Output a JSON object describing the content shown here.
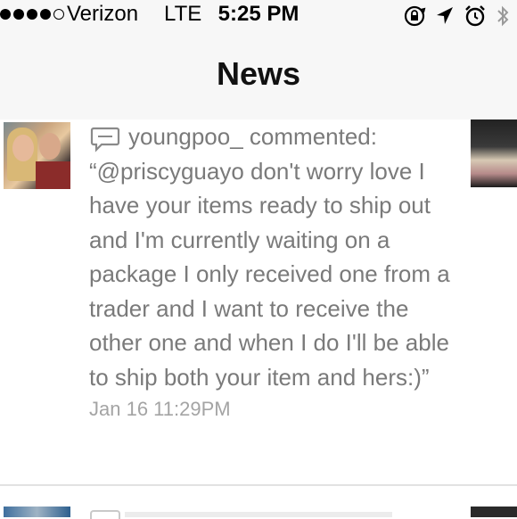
{
  "status_bar": {
    "carrier": "Verizon",
    "network": "LTE",
    "time": "5:25 PM",
    "signal_bars_filled": 4,
    "signal_bars_total": 5,
    "icons": [
      "rotation-lock-icon",
      "location-arrow-icon",
      "alarm-clock-icon",
      "bluetooth-icon"
    ]
  },
  "nav": {
    "title": "News"
  },
  "feed": {
    "items": [
      {
        "username": "youngpoo_",
        "action": "commented:",
        "comment": "“@priscyguayo don't worry love I have your items ready to ship out and I'm currently waiting on a package I only received one from a trader and I want to receive the other one and when I do I'll be able to ship both your item and hers:)”",
        "timestamp": "Jan 16 11:29PM",
        "icon": "comment-icon"
      }
    ]
  },
  "colors": {
    "text_gray": "#7a7a7a",
    "timestamp_gray": "#a4a4a4",
    "header_bg": "#f7f7f7",
    "divider": "#e2e2e2"
  }
}
